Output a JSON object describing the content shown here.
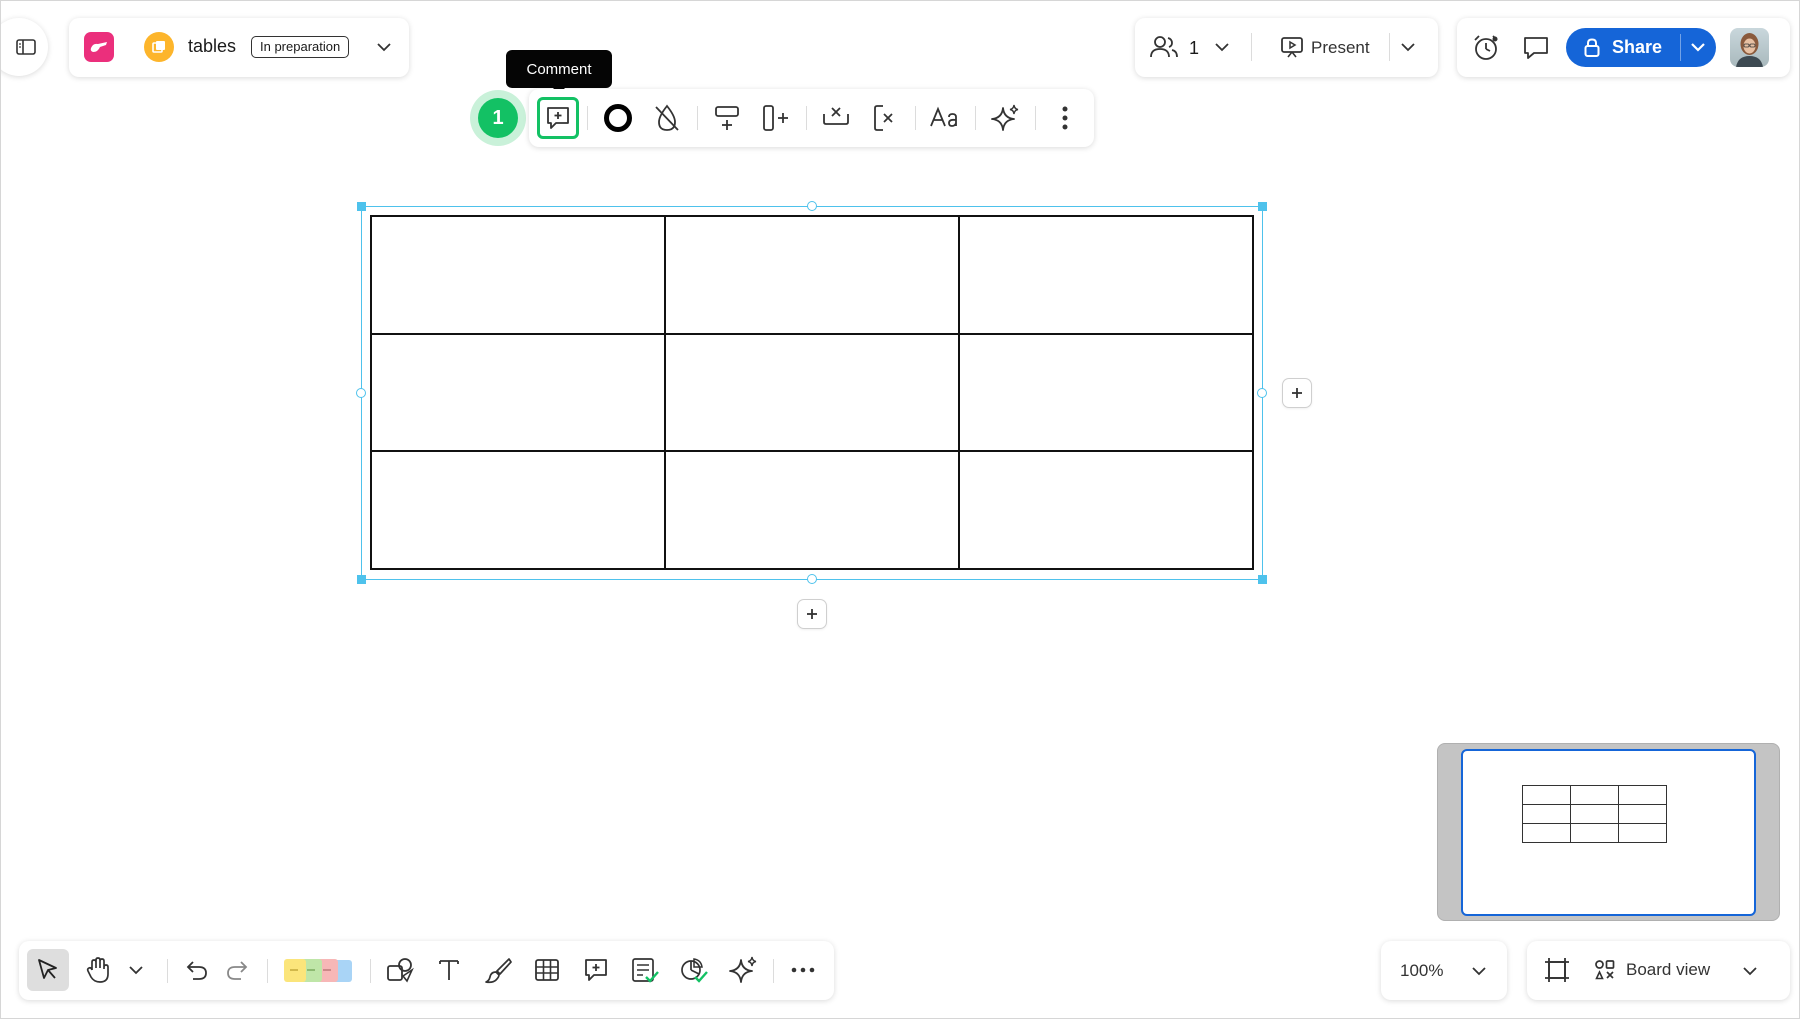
{
  "board": {
    "name": "tables",
    "status": "In preparation"
  },
  "collab": {
    "user_count": "1",
    "present_label": "Present"
  },
  "share": {
    "label": "Share"
  },
  "tooltip": {
    "text": "Comment"
  },
  "step": {
    "number": "1"
  },
  "context_toolbar": {
    "items": [
      "comment",
      "border-color",
      "fill-none",
      "add-row",
      "add-column",
      "delete-row",
      "delete-column",
      "text-style",
      "ai-assist",
      "more-options"
    ]
  },
  "table": {
    "rows": 3,
    "columns": 3,
    "cells": [
      [
        "",
        "",
        ""
      ],
      [
        "",
        "",
        ""
      ],
      [
        "",
        "",
        ""
      ]
    ]
  },
  "zoom": {
    "level": "100%"
  },
  "view": {
    "label": "Board view"
  },
  "colors": {
    "accent": "#1565d8",
    "selection": "#4ec2ec",
    "highlight": "#13c164",
    "logo": "#eb2f7c",
    "board_avatar": "#fdb52b"
  }
}
